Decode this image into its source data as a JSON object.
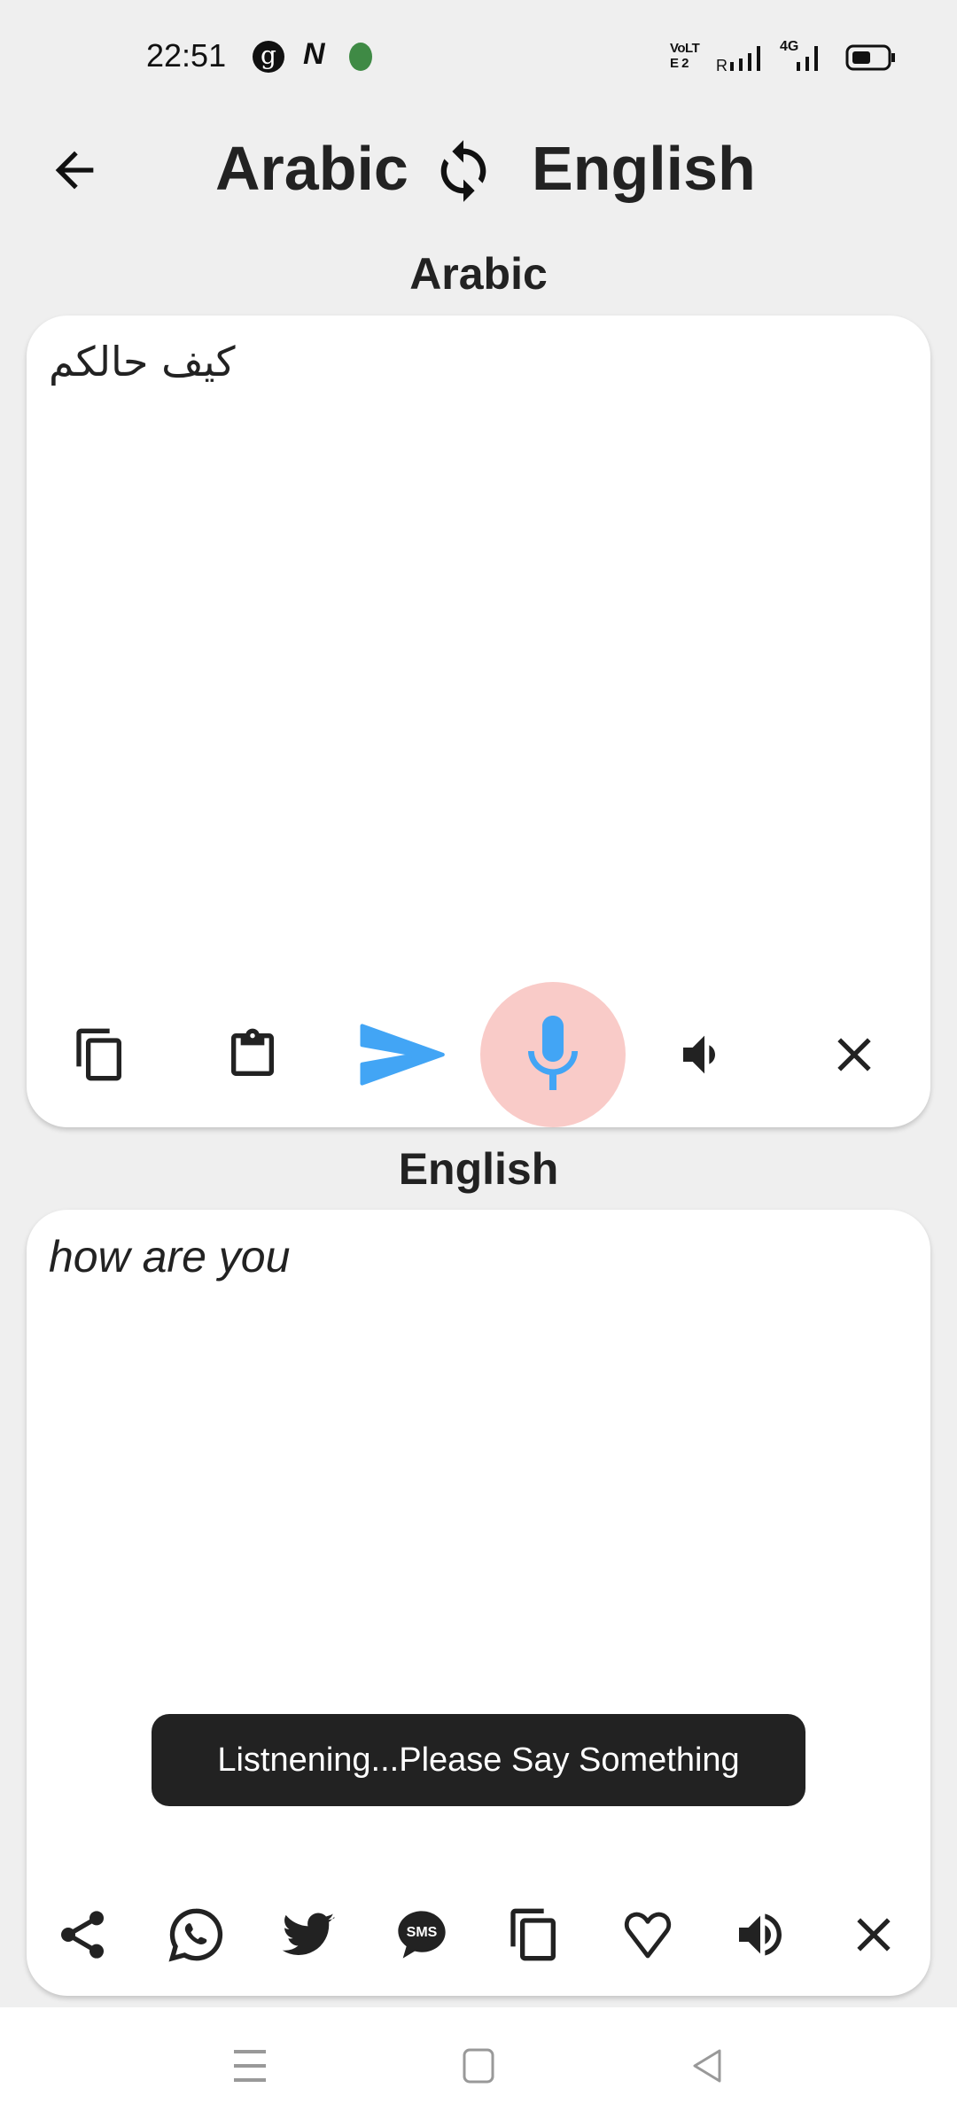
{
  "status_bar": {
    "time": "22:51",
    "network": "4G",
    "volte": "VoLTE 2",
    "roaming": "R"
  },
  "header": {
    "source_language": "Arabic",
    "target_language": "English",
    "back_icon": "arrow-left-icon",
    "swap_icon": "sync-icon"
  },
  "source_panel": {
    "label": "Arabic",
    "text": "كيف حالكم",
    "toolbar": [
      "copy-icon",
      "paste-icon",
      "send-icon",
      "mic-icon",
      "speaker-icon",
      "close-icon"
    ]
  },
  "target_panel": {
    "label": "English",
    "text": "how are you",
    "toolbar": [
      "share-icon",
      "whatsapp-icon",
      "twitter-icon",
      "sms-icon",
      "copy-icon",
      "heart-icon",
      "speaker-icon",
      "close-icon"
    ],
    "sms_text": "SMS"
  },
  "toast": {
    "text": "Listnening...Please Say Something"
  },
  "colors": {
    "accent": "#42a5f5",
    "mic_active_bg": "#f9cbc8",
    "toast_bg": "#222222"
  }
}
